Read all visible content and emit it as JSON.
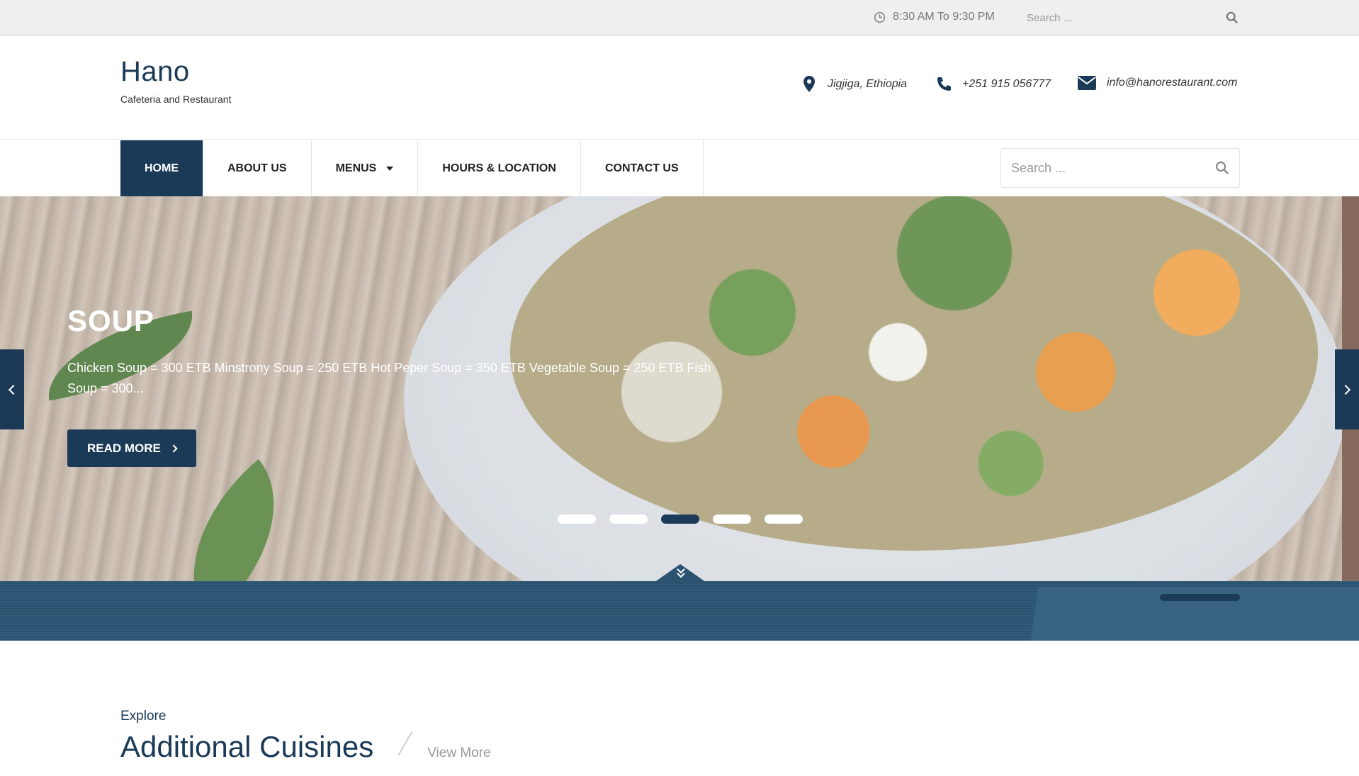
{
  "topbar": {
    "hours": "8:30 AM To 9:30 PM",
    "search_placeholder": "Search ..."
  },
  "header": {
    "site_name": "Hano",
    "tagline": "Cafeteria and Restaurant",
    "location": "Jigjiga, Ethiopia",
    "phone": "+251 915 056777",
    "email": "info@hanorestaurant.com"
  },
  "nav": {
    "items": [
      {
        "label": "HOME"
      },
      {
        "label": "ABOUT US"
      },
      {
        "label": "MENUS"
      },
      {
        "label": "HOURS & LOCATION"
      },
      {
        "label": "CONTACT US"
      }
    ],
    "search_placeholder": "Search ..."
  },
  "hero": {
    "title": "SOUP",
    "description": "Chicken Soup = 300 ETB Minstrony Soup = 250 ETB Hot Peper Soup = 350 ETB Vegetable Soup = 250 ETB Fish Soup = 300...",
    "button_label": "READ MORE",
    "slide_count": 5,
    "active_slide": 3
  },
  "section": {
    "kicker": "Explore",
    "heading": "Additional Cuisines",
    "view_more": "View More"
  },
  "colors": {
    "primary": "#1b3a57",
    "band": "#2b5370",
    "topbar": "#efefef"
  }
}
